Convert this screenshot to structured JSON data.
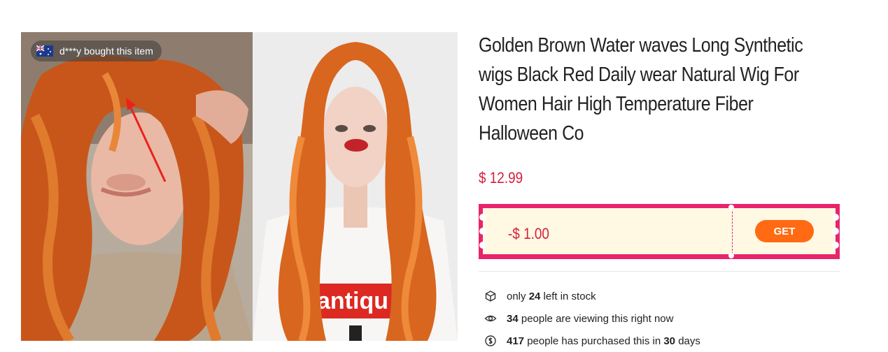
{
  "product": {
    "title": "Golden Brown Water waves Long Synthetic wigs Black Red Daily wear Natural Wig For Women Hair High Temperature Fiber Halloween Co",
    "price": "$ 12.99"
  },
  "toast": {
    "text": "d***y bought this item",
    "flag_icon": "australia-flag-icon"
  },
  "images": {
    "left_alt": "model with curly ginger wig",
    "right_alt": "mannequin with orange wavy wig",
    "shirt_text": "antiqu"
  },
  "coupon": {
    "amount": "-$ 1.00",
    "button_label": "GET",
    "color": "#e8246c"
  },
  "stats": {
    "stock_prefix": "only ",
    "stock_count": "24",
    "stock_suffix": " left in stock",
    "viewing_count": "34",
    "viewing_suffix": " people are viewing this right now",
    "purchased_count": "417",
    "purchased_mid": " people has purchased this in ",
    "purchased_days": "30",
    "purchased_suffix": " days"
  },
  "colors": {
    "price": "#d41e3a",
    "button": "#ff6a13"
  }
}
